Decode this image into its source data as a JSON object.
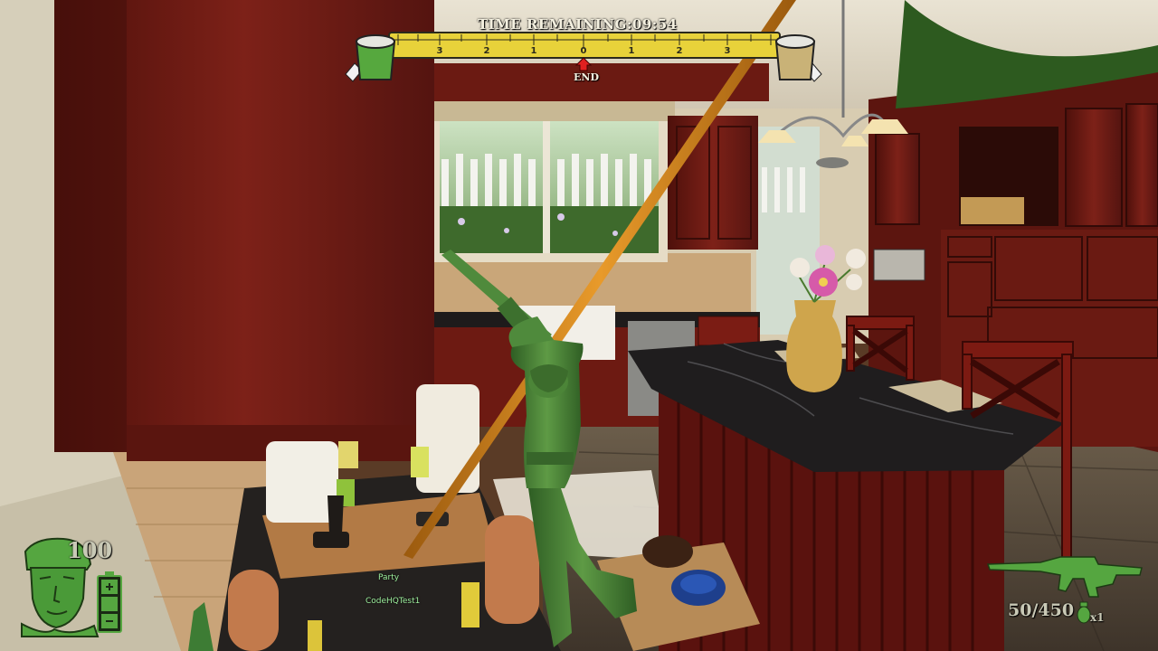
{
  "hud": {
    "time_label": "TIME REMAINING:",
    "time_value": "09:54",
    "end_label": "END",
    "ruler_ticks": [
      "3",
      "2",
      "1",
      "0",
      "1",
      "2",
      "3"
    ],
    "health": "100",
    "ammo": "50/450",
    "grenades": "x1"
  },
  "players": {
    "party_label": "Party",
    "name": "CodeHQTest1"
  },
  "colors": {
    "ruler": "#e8d23a",
    "army_green": "#4f8a3c",
    "hud_green": "#55a640",
    "cabinet_red": "#7a1d16"
  },
  "icons": {
    "team_left": "green-paint-can-icon",
    "team_right": "tan-paint-can-icon",
    "marker": "red-arrow-up-icon",
    "avatar": "soldier-head-icon",
    "battery": "battery-icon",
    "weapon": "rifle-icon",
    "grenade": "grenade-icon"
  }
}
